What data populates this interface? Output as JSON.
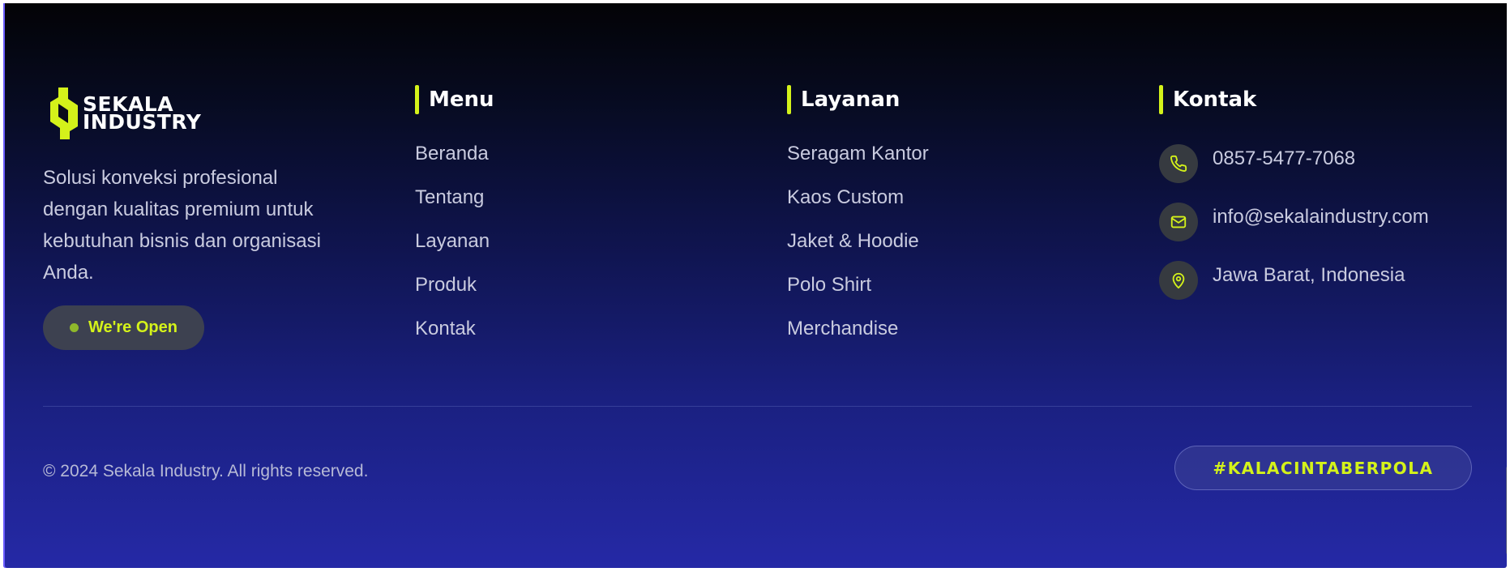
{
  "brand": {
    "logo_line1": "SEKALA",
    "logo_line2": "INDUSTRY",
    "tagline": "Solusi konveksi profesional dengan kualitas premium untuk kebutuhan bisnis dan organisasi Anda.",
    "status_label": "We're Open"
  },
  "menu": {
    "title": "Menu",
    "items": [
      "Beranda",
      "Tentang",
      "Layanan",
      "Produk",
      "Kontak"
    ]
  },
  "services": {
    "title": "Layanan",
    "items": [
      "Seragam Kantor",
      "Kaos Custom",
      "Jaket & Hoodie",
      "Polo Shirt",
      "Merchandise"
    ]
  },
  "contact": {
    "title": "Kontak",
    "items": [
      {
        "icon": "phone-icon",
        "text": "0857-5477-7068"
      },
      {
        "icon": "mail-icon",
        "text": "info@sekalaindustry.com"
      },
      {
        "icon": "location-pin-icon",
        "text": "Jawa Barat, Indonesia"
      }
    ]
  },
  "footer_bottom": {
    "copyright": "© 2024 Sekala Industry. All rights reserved.",
    "hashtag": "#KALACINTABERPOLA"
  },
  "colors": {
    "accent": "#d4f21a",
    "background_top": "#030306",
    "background_bottom": "#2529a6",
    "text_muted": "#c9cbdf",
    "icon_circle": "#363a40"
  }
}
